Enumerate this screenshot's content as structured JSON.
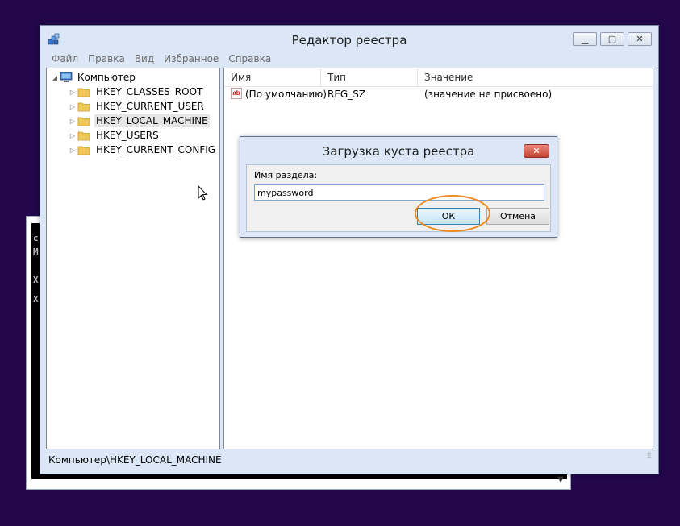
{
  "console": {
    "chars": [
      "c",
      "M",
      "X",
      "X"
    ]
  },
  "regedit": {
    "title": "Редактор реестра",
    "menu": [
      "Файл",
      "Правка",
      "Вид",
      "Избранное",
      "Справка"
    ],
    "tree": {
      "root": "Компьютер",
      "keys": [
        "HKEY_CLASSES_ROOT",
        "HKEY_CURRENT_USER",
        "HKEY_LOCAL_MACHINE",
        "HKEY_USERS",
        "HKEY_CURRENT_CONFIG"
      ],
      "selected": "HKEY_LOCAL_MACHINE"
    },
    "columns": {
      "name": "Имя",
      "type": "Тип",
      "value": "Значение"
    },
    "rows": [
      {
        "name": "(По умолчанию)",
        "type": "REG_SZ",
        "value": "(значение не присвоено)"
      }
    ],
    "status": "Компьютер\\HKEY_LOCAL_MACHINE"
  },
  "dialog": {
    "title": "Загрузка куста реестра",
    "field_label": "Имя раздела:",
    "field_value": "mypassword",
    "ok_label": "ОК",
    "cancel_label": "Отмена"
  },
  "colors": {
    "desktop": "#23074a",
    "highlight_ring": "#ef8a1f",
    "close_button": "#c54232"
  }
}
